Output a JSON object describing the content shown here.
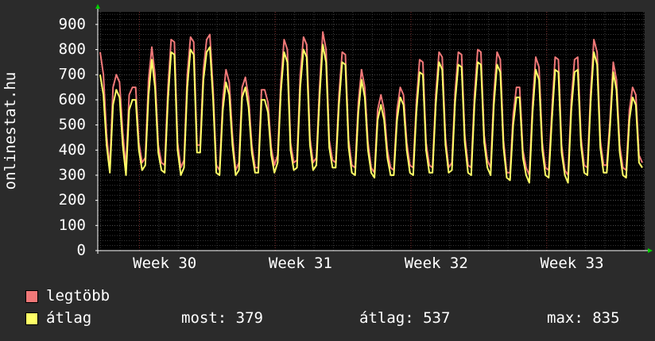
{
  "chart_data": {
    "type": "line",
    "ylabel": "onlinestat.hu",
    "ylim": [
      0,
      950
    ],
    "yticks": [
      0,
      100,
      200,
      300,
      400,
      500,
      600,
      700,
      800,
      900
    ],
    "xticks": [
      "Week 30",
      "Week 31",
      "Week 32",
      "Week 33"
    ],
    "grid": true,
    "colors": {
      "background": "#2b2b2b",
      "plot_background": "#000000",
      "grid": "#3a3a3a",
      "week_grid": "#7a2a2a",
      "axis": "#ffffff",
      "arrow": "#00cc00",
      "legtobb": "#f07878",
      "atlag": "#ffff66"
    },
    "series": [
      {
        "name": "legtöbb",
        "color": "#f07878",
        "values": [
          790,
          700,
          460,
          330,
          650,
          700,
          670,
          470,
          330,
          620,
          650,
          650,
          430,
          350,
          370,
          680,
          810,
          700,
          420,
          350,
          340,
          650,
          840,
          830,
          430,
          330,
          360,
          700,
          850,
          830,
          420,
          420,
          720,
          840,
          860,
          640,
          340,
          320,
          600,
          720,
          670,
          460,
          320,
          350,
          650,
          690,
          610,
          420,
          330,
          330,
          640,
          640,
          590,
          410,
          340,
          380,
          670,
          840,
          800,
          430,
          350,
          360,
          700,
          850,
          820,
          450,
          350,
          370,
          650,
          870,
          800,
          440,
          360,
          350,
          620,
          790,
          780,
          440,
          340,
          330,
          590,
          720,
          650,
          430,
          330,
          310,
          560,
          620,
          560,
          400,
          330,
          320,
          560,
          650,
          620,
          430,
          340,
          330,
          590,
          760,
          750,
          430,
          340,
          330,
          620,
          790,
          770,
          450,
          330,
          350,
          630,
          790,
          780,
          460,
          340,
          330,
          620,
          800,
          790,
          460,
          360,
          330,
          620,
          790,
          760,
          440,
          310,
          310,
          540,
          650,
          650,
          400,
          330,
          300,
          590,
          770,
          730,
          430,
          330,
          320,
          560,
          770,
          760,
          420,
          320,
          300,
          600,
          760,
          770,
          450,
          340,
          330,
          630,
          840,
          790,
          440,
          340,
          340,
          520,
          750,
          680,
          420,
          330,
          320,
          560,
          650,
          620,
          380,
          350
        ]
      },
      {
        "name": "átlag",
        "color": "#ffff66",
        "values": [
          700,
          620,
          420,
          310,
          580,
          640,
          610,
          420,
          300,
          560,
          600,
          600,
          400,
          320,
          340,
          620,
          760,
          650,
          390,
          320,
          310,
          600,
          790,
          780,
          400,
          300,
          330,
          650,
          800,
          780,
          390,
          390,
          680,
          790,
          810,
          600,
          310,
          300,
          560,
          670,
          620,
          420,
          300,
          320,
          610,
          650,
          570,
          390,
          310,
          310,
          600,
          600,
          550,
          380,
          310,
          350,
          630,
          790,
          750,
          400,
          320,
          330,
          650,
          800,
          770,
          420,
          320,
          340,
          610,
          820,
          750,
          410,
          330,
          330,
          580,
          750,
          740,
          410,
          310,
          300,
          550,
          680,
          610,
          400,
          310,
          290,
          520,
          580,
          520,
          370,
          300,
          300,
          520,
          610,
          580,
          400,
          310,
          300,
          550,
          710,
          700,
          400,
          310,
          310,
          580,
          750,
          720,
          420,
          310,
          320,
          590,
          740,
          730,
          430,
          310,
          300,
          580,
          750,
          740,
          430,
          330,
          300,
          580,
          740,
          710,
          410,
          290,
          280,
          500,
          610,
          610,
          370,
          300,
          270,
          550,
          720,
          680,
          400,
          300,
          290,
          520,
          720,
          710,
          390,
          300,
          270,
          560,
          710,
          720,
          420,
          310,
          300,
          590,
          790,
          740,
          410,
          310,
          310,
          490,
          710,
          640,
          390,
          300,
          290,
          520,
          610,
          580,
          350,
          330
        ]
      }
    ],
    "stats": {
      "now_label": "most: 379",
      "avg_label": "átlag: 537",
      "max_label": "max: 835"
    }
  }
}
